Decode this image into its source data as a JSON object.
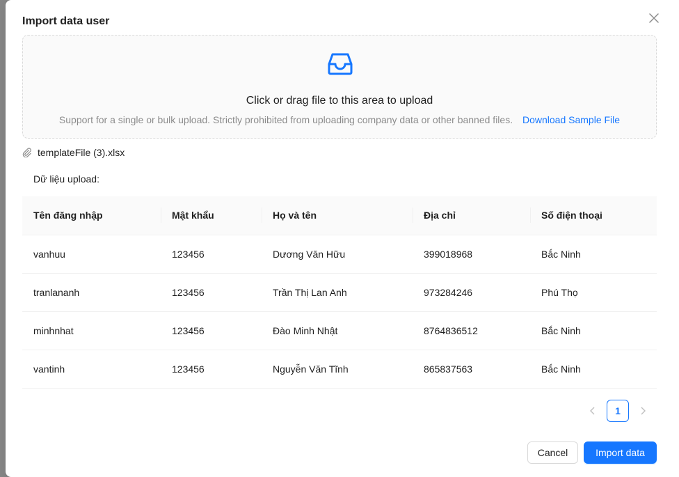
{
  "modal": {
    "title": "Import data user",
    "close_icon": "close-icon"
  },
  "dropzone": {
    "icon": "inbox-icon",
    "text": "Click or drag file to this area to upload",
    "hint": "Support for a single or bulk upload. Strictly prohibited from uploading company data or other banned files.",
    "download_link": "Download Sample File"
  },
  "file": {
    "icon": "paperclip-icon",
    "name": "templateFile (3).xlsx"
  },
  "data_label": "Dữ liệu upload:",
  "table": {
    "columns": [
      "Tên đăng nhập",
      "Mật khẩu",
      "Họ và tên",
      "Địa chỉ",
      "Số điện thoại"
    ],
    "rows": [
      [
        "vanhuu",
        "123456",
        "Dương Văn Hữu",
        "399018968",
        "Bắc Ninh"
      ],
      [
        "tranlananh",
        "123456",
        "Trần Thị Lan Anh",
        "973284246",
        "Phú Thọ"
      ],
      [
        "minhnhat",
        "123456",
        "Đào Minh Nhật",
        "8764836512",
        "Bắc Ninh"
      ],
      [
        "vantinh",
        "123456",
        "Nguyễn Văn Tĩnh",
        "865837563",
        "Bắc Ninh"
      ]
    ]
  },
  "pagination": {
    "current_page": "1",
    "prev_icon": "chevron-left-icon",
    "next_icon": "chevron-right-icon"
  },
  "footer": {
    "cancel_label": "Cancel",
    "import_label": "Import data"
  },
  "colors": {
    "primary": "#1677ff",
    "header_bg": "#fafafa",
    "border": "#f0f0f0"
  }
}
